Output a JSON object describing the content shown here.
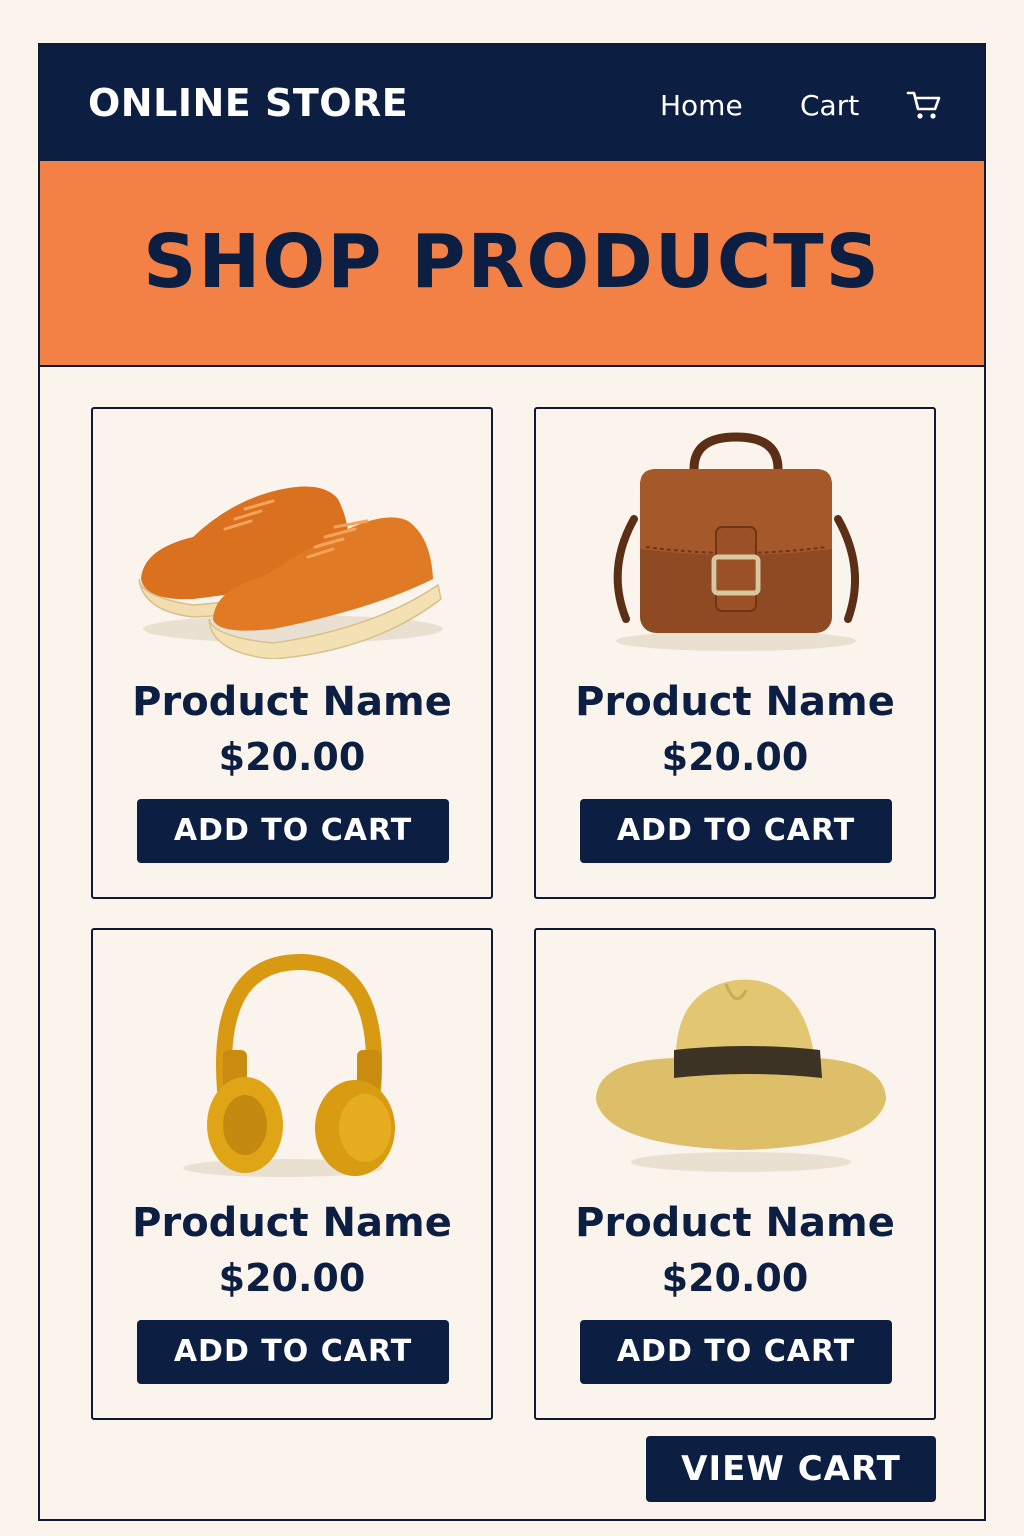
{
  "header": {
    "logo": "ONLINE STORE",
    "nav": [
      {
        "label": "Home"
      },
      {
        "label": "Cart"
      }
    ],
    "cart_icon": "shopping-cart-icon"
  },
  "hero": {
    "title": "SHOP PRODUCTS"
  },
  "products": [
    {
      "name": "Product Name",
      "price": "$20.00",
      "button": "ADD TO CART",
      "image": "orange-sneakers-image"
    },
    {
      "name": "Product Name",
      "price": "$20.00",
      "button": "ADD TO CART",
      "image": "brown-leather-bag-image"
    },
    {
      "name": "Product Name",
      "price": "$20.00",
      "button": "ADD TO CART",
      "image": "yellow-headphones-image"
    },
    {
      "name": "Product Name",
      "price": "$20.00",
      "button": "ADD TO CART",
      "image": "straw-fedora-hat-image"
    }
  ],
  "footer": {
    "view_cart": "VIEW CART"
  },
  "colors": {
    "navy": "#0c1e42",
    "orange": "#f38146",
    "background": "#faf4ec"
  }
}
